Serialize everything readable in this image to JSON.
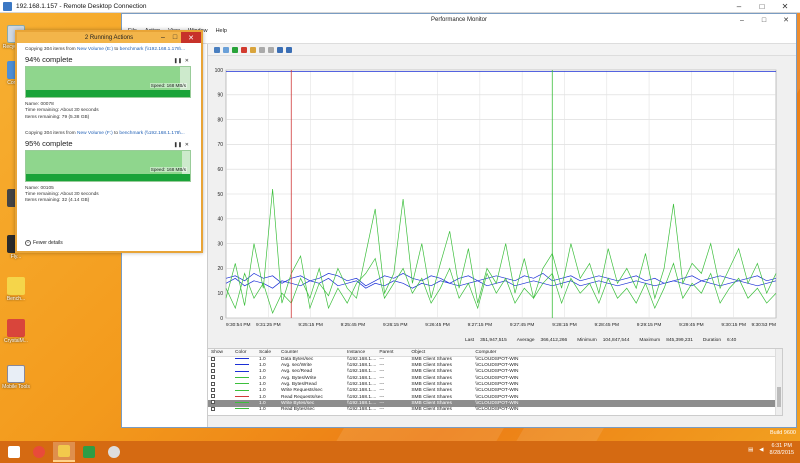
{
  "rdp": {
    "title": "192.168.1.157 - Remote Desktop Connection"
  },
  "desktop": {
    "icons": [
      {
        "label": "Recycle Bin"
      },
      {
        "label": "Comp..."
      },
      {
        "label": ""
      },
      {
        "label": "Fly..."
      },
      {
        "label": "Bench..."
      },
      {
        "label": "CrystalM..."
      },
      {
        "label": "Mobile Tools"
      }
    ],
    "brand_line1": "Windows Server 2012 R2",
    "brand_line2": "Build 9600"
  },
  "copy_window": {
    "title": "2 Running Actions",
    "ops": [
      {
        "prefix": "Copying 304 items from ",
        "from": "New Volume (E:)",
        "mid": " to ",
        "to": "benchmark (\\\\192.168.1.178\\...",
        "percent": "94% complete",
        "progress": 0.94,
        "speed": "Speed: 168 MB/s",
        "name": "Name: 00078",
        "time": "Time remaining: About 30 seconds",
        "items": "Items remaining: 79 (5.38 GB)"
      },
      {
        "prefix": "Copying 304 items from ",
        "from": "New Volume (F:)",
        "mid": " to ",
        "to": "benchmark (\\\\192.168.1.178\\...",
        "percent": "95% complete",
        "progress": 0.95,
        "speed": "Speed: 168 MB/s",
        "name": "Name: 00105",
        "time": "Time remaining: About 30 seconds",
        "items": "Items remaining: 32 (4.14 GB)"
      }
    ],
    "fewer_details": "Fewer details"
  },
  "perfmon": {
    "title": "Performance Monitor",
    "menu": [
      "File",
      "Action",
      "View",
      "Window",
      "Help"
    ],
    "stats": {
      "last_label": "Last",
      "last": "351,947,515",
      "avg_label": "Average",
      "avg": "366,412,266",
      "min_label": "Minimum",
      "min": "104,847,544",
      "max_label": "Maximum",
      "max": "845,399,231",
      "dur_label": "Duration",
      "dur": "6:40"
    },
    "columns": [
      "Show",
      "Color",
      "Scale",
      "Counter",
      "Instance",
      "Parent",
      "Object",
      "Computer"
    ],
    "counters": [
      {
        "color": "#1b2fd6",
        "scale": "1.0",
        "counter": "Data Bytes/sec",
        "instance": "\\\\192.168.1....",
        "parent": "---",
        "object": "SMB Client Shares",
        "computer": "\\\\CLOUDSPOT-WIN"
      },
      {
        "color": "#1b2fd6",
        "scale": "1.0",
        "counter": "Avg. sec/Write",
        "instance": "\\\\192.168.1....",
        "parent": "---",
        "object": "SMB Client Shares",
        "computer": "\\\\CLOUDSPOT-WIN"
      },
      {
        "color": "#1b2fd6",
        "scale": "1.0",
        "counter": "Avg. sec/Read",
        "instance": "\\\\192.168.1....",
        "parent": "---",
        "object": "SMB Client Shares",
        "computer": "\\\\CLOUDSPOT-WIN"
      },
      {
        "color": "#3cbf3c",
        "scale": "1.0",
        "counter": "Avg. Bytes/Write",
        "instance": "\\\\192.168.1....",
        "parent": "---",
        "object": "SMB Client Shares",
        "computer": "\\\\CLOUDSPOT-WIN"
      },
      {
        "color": "#3cbf3c",
        "scale": "1.0",
        "counter": "Avg. Bytes/Read",
        "instance": "\\\\192.168.1....",
        "parent": "---",
        "object": "SMB Client Shares",
        "computer": "\\\\CLOUDSPOT-WIN"
      },
      {
        "color": "#3cbf3c",
        "scale": "1.0",
        "counter": "Write Requests/sec",
        "instance": "\\\\192.168.1....",
        "parent": "---",
        "object": "SMB Client Shares",
        "computer": "\\\\CLOUDSPOT-WIN"
      },
      {
        "color": "#d03a3a",
        "scale": "1.0",
        "counter": "Read Requests/sec",
        "instance": "\\\\192.168.1....",
        "parent": "---",
        "object": "SMB Client Shares",
        "computer": "\\\\CLOUDSPOT-WIN"
      },
      {
        "color": "#3cbf3c",
        "scale": "1.0",
        "counter": "Write Bytes/sec",
        "instance": "\\\\192.168.1....",
        "parent": "---",
        "object": "SMB Client Shares",
        "computer": "\\\\CLOUDSPOT-WIN",
        "selected": true
      },
      {
        "color": "#3cbf3c",
        "scale": "1.0",
        "counter": "Read Bytes/sec",
        "instance": "\\\\192.168.1....",
        "parent": "---",
        "object": "SMB Client Shares",
        "computer": "\\\\CLOUDSPOT-WIN"
      }
    ]
  },
  "taskbar": {
    "clock_time": "6:31 PM",
    "clock_date": "8/28/2015"
  },
  "chart_data": {
    "type": "line",
    "ylim": [
      0,
      100
    ],
    "yticks": [
      0,
      10,
      20,
      30,
      40,
      50,
      60,
      70,
      80,
      90,
      100
    ],
    "xticks": [
      "9:30:54 PM",
      "9:31:25 PM",
      "9:25:15 PM",
      "9:25:45 PM",
      "9:26:15 PM",
      "9:26:45 PM",
      "9:27:15 PM",
      "9:27:45 PM",
      "9:28:15 PM",
      "9:28:45 PM",
      "9:29:15 PM",
      "9:29:45 PM",
      "9:30:15 PM",
      "9:30:53 PM"
    ],
    "grid": true,
    "series": [
      {
        "color": "#1b2fd6",
        "values": [
          16,
          17,
          15,
          18,
          16,
          17,
          14,
          16,
          17,
          15,
          16,
          18,
          17,
          15,
          16,
          13,
          15,
          17,
          16,
          18,
          16,
          15,
          17,
          16,
          14,
          16,
          17,
          15,
          16,
          17,
          16,
          15,
          17,
          16,
          18,
          15,
          16,
          17,
          15,
          16,
          17,
          16,
          15,
          16,
          17,
          15,
          16,
          14,
          15,
          16,
          17,
          15,
          16,
          17,
          16,
          15,
          16,
          17,
          15,
          16
        ]
      },
      {
        "color": "#1b2fd6",
        "values": [
          14,
          16,
          13,
          15,
          14,
          12,
          15,
          14,
          13,
          15,
          14,
          16,
          13,
          14,
          15,
          12,
          14,
          13,
          15,
          14,
          12,
          14,
          13,
          15,
          14,
          13,
          14,
          15,
          13,
          14,
          15,
          13,
          14,
          15,
          14,
          13,
          14,
          15,
          13,
          14,
          15,
          14,
          13,
          14,
          15,
          14,
          13,
          14,
          15,
          14,
          13,
          15,
          14,
          13,
          14,
          15,
          14,
          13,
          14,
          15
        ]
      },
      {
        "color": "#3cbf3c",
        "values": [
          8,
          22,
          5,
          30,
          12,
          52,
          6,
          18,
          25,
          4,
          14,
          9,
          20,
          12,
          8,
          26,
          44,
          10,
          18,
          48,
          14,
          30,
          8,
          22,
          35,
          12,
          28,
          6,
          20,
          14,
          30,
          10,
          24,
          8,
          20,
          26,
          12,
          30,
          16,
          22,
          10,
          28,
          14,
          20,
          12,
          26,
          8,
          20,
          46,
          14,
          22,
          18,
          30,
          12,
          20,
          28,
          14,
          22,
          10,
          18
        ]
      },
      {
        "color": "#3cbf3c",
        "values": [
          12,
          4,
          18,
          8,
          14,
          2,
          10,
          6,
          16,
          8,
          20,
          4,
          12,
          6,
          14,
          18,
          24,
          8,
          14,
          20,
          10,
          16,
          6,
          12,
          20,
          8,
          14,
          4,
          18,
          10,
          16,
          6,
          12,
          8,
          14,
          18,
          6,
          16,
          10,
          14,
          6,
          16,
          8,
          12,
          6,
          14,
          4,
          12,
          22,
          8,
          14,
          10,
          18,
          6,
          12,
          16,
          8,
          12,
          6,
          10
        ]
      }
    ],
    "markers": [
      {
        "color": "#d03a3a",
        "x_index": 7
      },
      {
        "color": "#3cbf3c",
        "x_index": 35
      }
    ]
  }
}
